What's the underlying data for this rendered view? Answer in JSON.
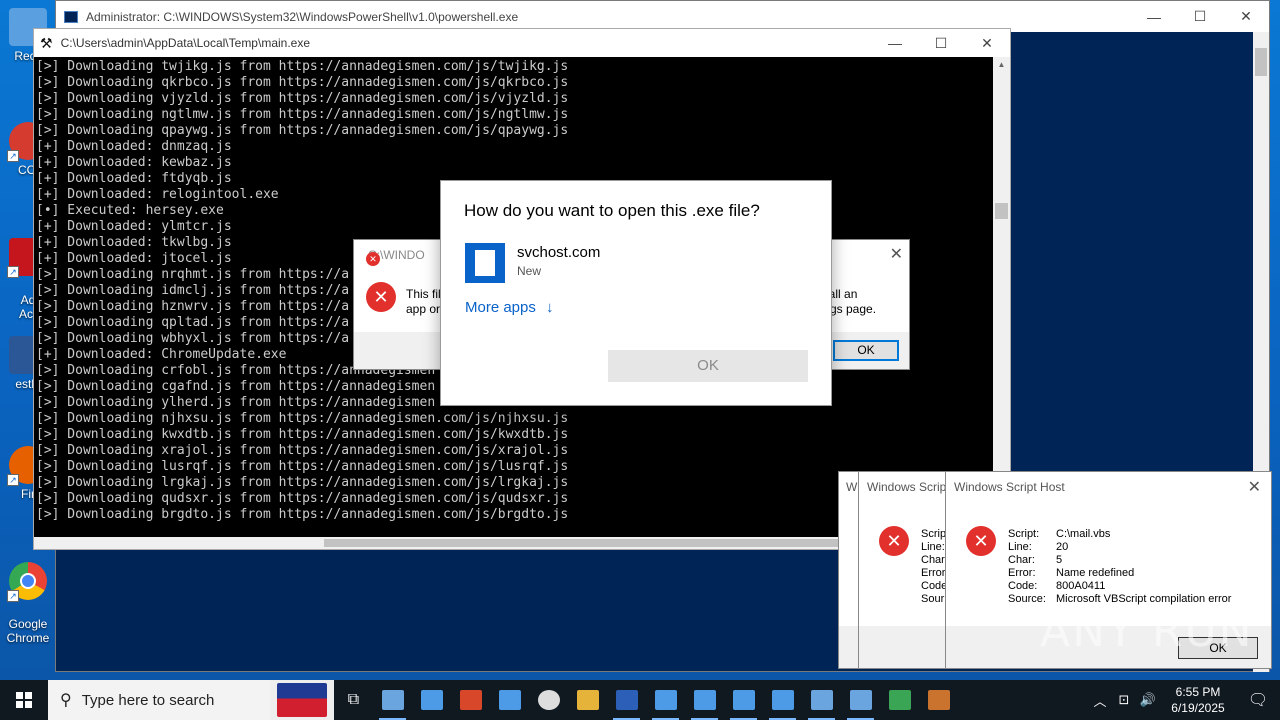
{
  "desktop": {
    "icons": [
      {
        "label": "Recy",
        "color": "#5aa0e0"
      },
      {
        "label": "CCl",
        "color": "#d63b2f"
      },
      {
        "label": "Ad\nAcr",
        "color": "#c4161c"
      },
      {
        "label": "estbl",
        "color": "#2b5797"
      },
      {
        "label": "Fir",
        "color": "#e66000"
      },
      {
        "label": "Google\nChrome",
        "color": "#4285f4"
      }
    ]
  },
  "powershell": {
    "title": "Administrator: C:\\WINDOWS\\System32\\WindowsPowerShell\\v1.0\\powershell.exe"
  },
  "console": {
    "title": "C:\\Users\\admin\\AppData\\Local\\Temp\\main.exe",
    "lines": [
      "[>] Downloading twjikg.js from https://annadegismen.com/js/twjikg.js",
      "[>] Downloading qkrbco.js from https://annadegismen.com/js/qkrbco.js",
      "[>] Downloading vjyzld.js from https://annadegismen.com/js/vjyzld.js",
      "[>] Downloading ngtlmw.js from https://annadegismen.com/js/ngtlmw.js",
      "[>] Downloading qpaywg.js from https://annadegismen.com/js/qpaywg.js",
      "[+] Downloaded: dnmzaq.js",
      "[+] Downloaded: kewbaz.js",
      "[+] Downloaded: ftdyqb.js",
      "[+] Downloaded: relogintool.exe",
      "[•] Executed: hersey.exe",
      "[+] Downloaded: ylmtcr.js",
      "[+] Downloaded: tkwlbg.js",
      "[+] Downloaded: jtocel.js",
      "[>] Downloading nrqhmt.js from https://a",
      "[>] Downloading idmclj.js from https://a",
      "[>] Downloading hznwrv.js from https://a",
      "[>] Downloading qpltad.js from https://a",
      "[>] Downloading wbhyxl.js from https://a",
      "[+] Downloaded: ChromeUpdate.exe",
      "[>] Downloading crfobl.js from https://annadegismen",
      "[>] Downloading cgafnd.js from https://annadegismen",
      "[>] Downloading ylherd.js from https://annadegismen",
      "[>] Downloading njhxsu.js from https://annadegismen.com/js/njhxsu.js",
      "[>] Downloading kwxdtb.js from https://annadegismen.com/js/kwxdtb.js",
      "[>] Downloading xrajol.js from https://annadegismen.com/js/xrajol.js",
      "[>] Downloading lusrqf.js from https://annadegismen.com/js/lusrqf.js",
      "[>] Downloading lrgkaj.js from https://annadegismen.com/js/lrgkaj.js",
      "[>] Downloading qudsxr.js from https://annadegismen.com/js/qudsxr.js",
      "[>] Downloading brgdto.js from https://annadegismen.com/js/brgdto.js"
    ]
  },
  "error_dialog": {
    "title": "C:\\WINDO",
    "msg_left_1": "This fil",
    "msg_left_2": "app or",
    "msg_right_1": "e install an",
    "msg_right_2": "gs page.",
    "ok": "OK"
  },
  "open_with": {
    "question": "How do you want to open this .exe file?",
    "app_name": "svchost.com",
    "app_sub": "New",
    "more_apps": "More apps",
    "more_arrow": "↓",
    "ok": "OK"
  },
  "wsh_back": {
    "title_cut": "W",
    "title": "Windows Scrip",
    "labels": [
      "Scrip",
      "Line:",
      "Char",
      "Error",
      "Code",
      "Sour"
    ]
  },
  "wsh_front": {
    "title": "Windows Script Host",
    "rows": [
      {
        "k": "Script:",
        "v": "C:\\mail.vbs"
      },
      {
        "k": "Line:",
        "v": "20"
      },
      {
        "k": "Char:",
        "v": "5"
      },
      {
        "k": "Error:",
        "v": "Name redefined"
      },
      {
        "k": "Code:",
        "v": "800A0411"
      },
      {
        "k": "Source:",
        "v": "Microsoft VBScript compilation error"
      }
    ],
    "ok": "OK"
  },
  "watermark": "ANY RUN",
  "taskbar": {
    "search_placeholder": "Type here to search",
    "clock_time": "6:55 PM",
    "clock_date": "6/19/2025"
  }
}
